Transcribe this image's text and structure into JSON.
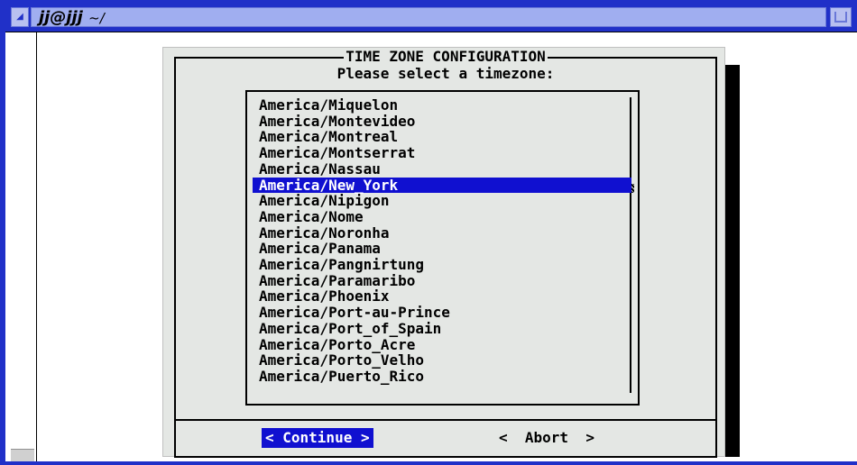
{
  "window": {
    "title": "jj@jjj",
    "title_suffix": "~/",
    "menu_glyph": "◢"
  },
  "dialog": {
    "title": "TIME ZONE CONFIGURATION",
    "prompt": "Please select a timezone:",
    "timezones": [
      "America/Miquelon",
      "America/Montevideo",
      "America/Montreal",
      "America/Montserrat",
      "America/Nassau",
      "America/New_York",
      "America/Nipigon",
      "America/Nome",
      "America/Noronha",
      "America/Panama",
      "America/Pangnirtung",
      "America/Paramaribo",
      "America/Phoenix",
      "America/Port-au-Prince",
      "America/Port_of_Spain",
      "America/Porto_Acre",
      "America/Porto_Velho",
      "America/Puerto_Rico"
    ],
    "selected_timezone": "America/New_York",
    "buttons": {
      "continue": "< Continue >",
      "abort": "<  Abort  >"
    }
  },
  "colors": {
    "title_bar": "#2030c8",
    "highlight": "#1010d0",
    "dialog_bg": "#e4e7e4"
  }
}
